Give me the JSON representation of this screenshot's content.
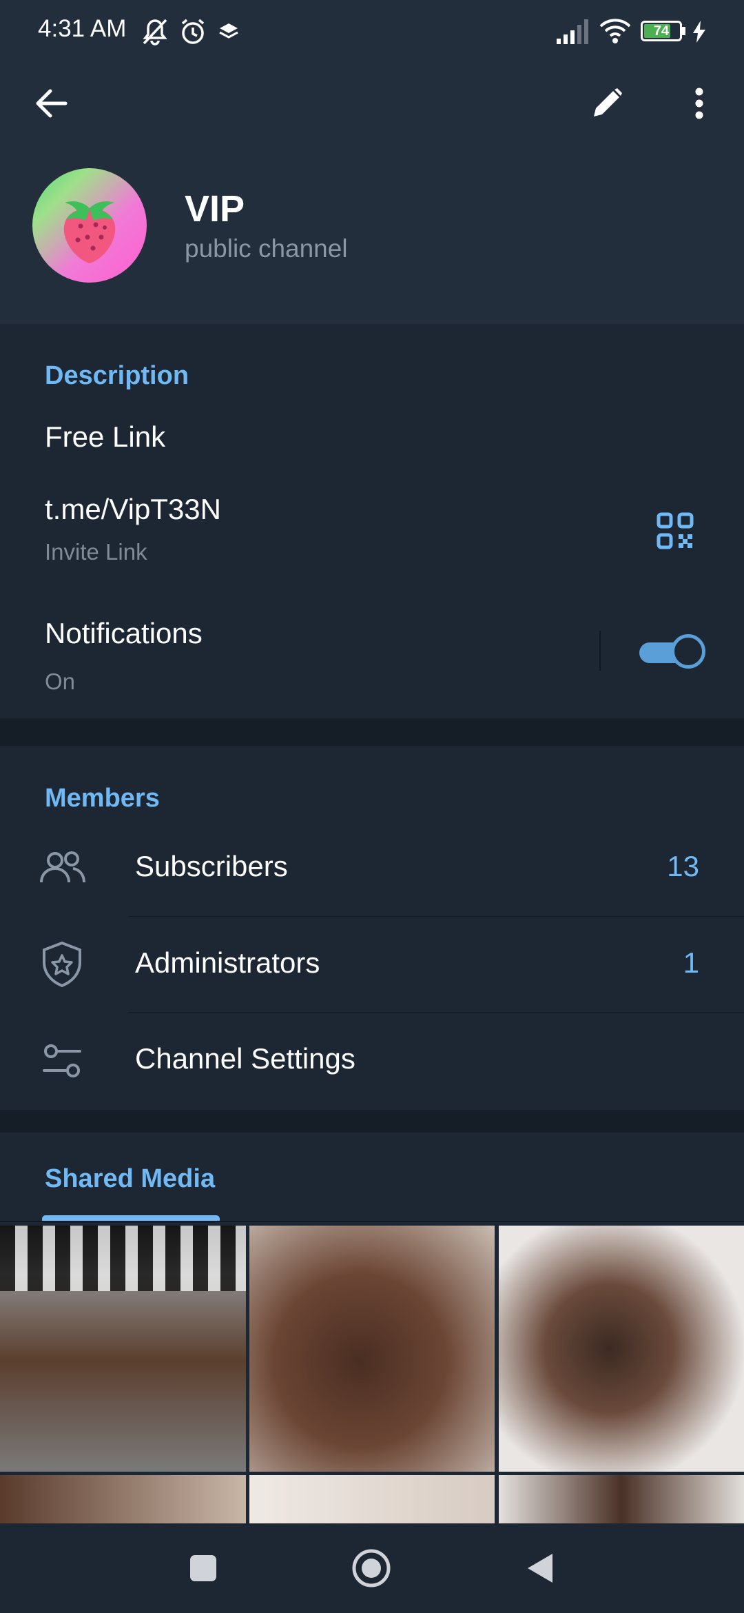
{
  "status_bar": {
    "time": "4:31 AM",
    "battery": "74",
    "icons": [
      "mute-icon",
      "alarm-icon",
      "layers-icon",
      "signal-icon",
      "wifi-icon",
      "battery-icon",
      "charging-icon"
    ]
  },
  "header": {
    "back_icon": "arrow-left-icon",
    "edit_icon": "pencil-icon",
    "more_icon": "more-vertical-icon"
  },
  "channel": {
    "name": "VIP",
    "type": "public channel",
    "avatar_icon": "strawberry-icon"
  },
  "info": {
    "description_title": "Description",
    "description_text": "Free Link",
    "invite_link": "t.me/VipT33N",
    "invite_label": "Invite Link",
    "qr_icon": "qr-code-icon",
    "notifications_label": "Notifications",
    "notifications_value": "On",
    "notifications_enabled": true
  },
  "members": {
    "title": "Members",
    "items": [
      {
        "label": "Subscribers",
        "count": "13",
        "icon": "users-icon"
      },
      {
        "label": "Administrators",
        "count": "1",
        "icon": "shield-star-icon"
      },
      {
        "label": "Channel Settings",
        "count": "",
        "icon": "sliders-icon"
      }
    ]
  },
  "media": {
    "title": "Shared Media",
    "tiles": 6
  },
  "colors": {
    "accent": "#71b9f4",
    "header_bg": "#232e3c",
    "body_bg": "#1d2733",
    "gap_bg": "#151e27"
  }
}
